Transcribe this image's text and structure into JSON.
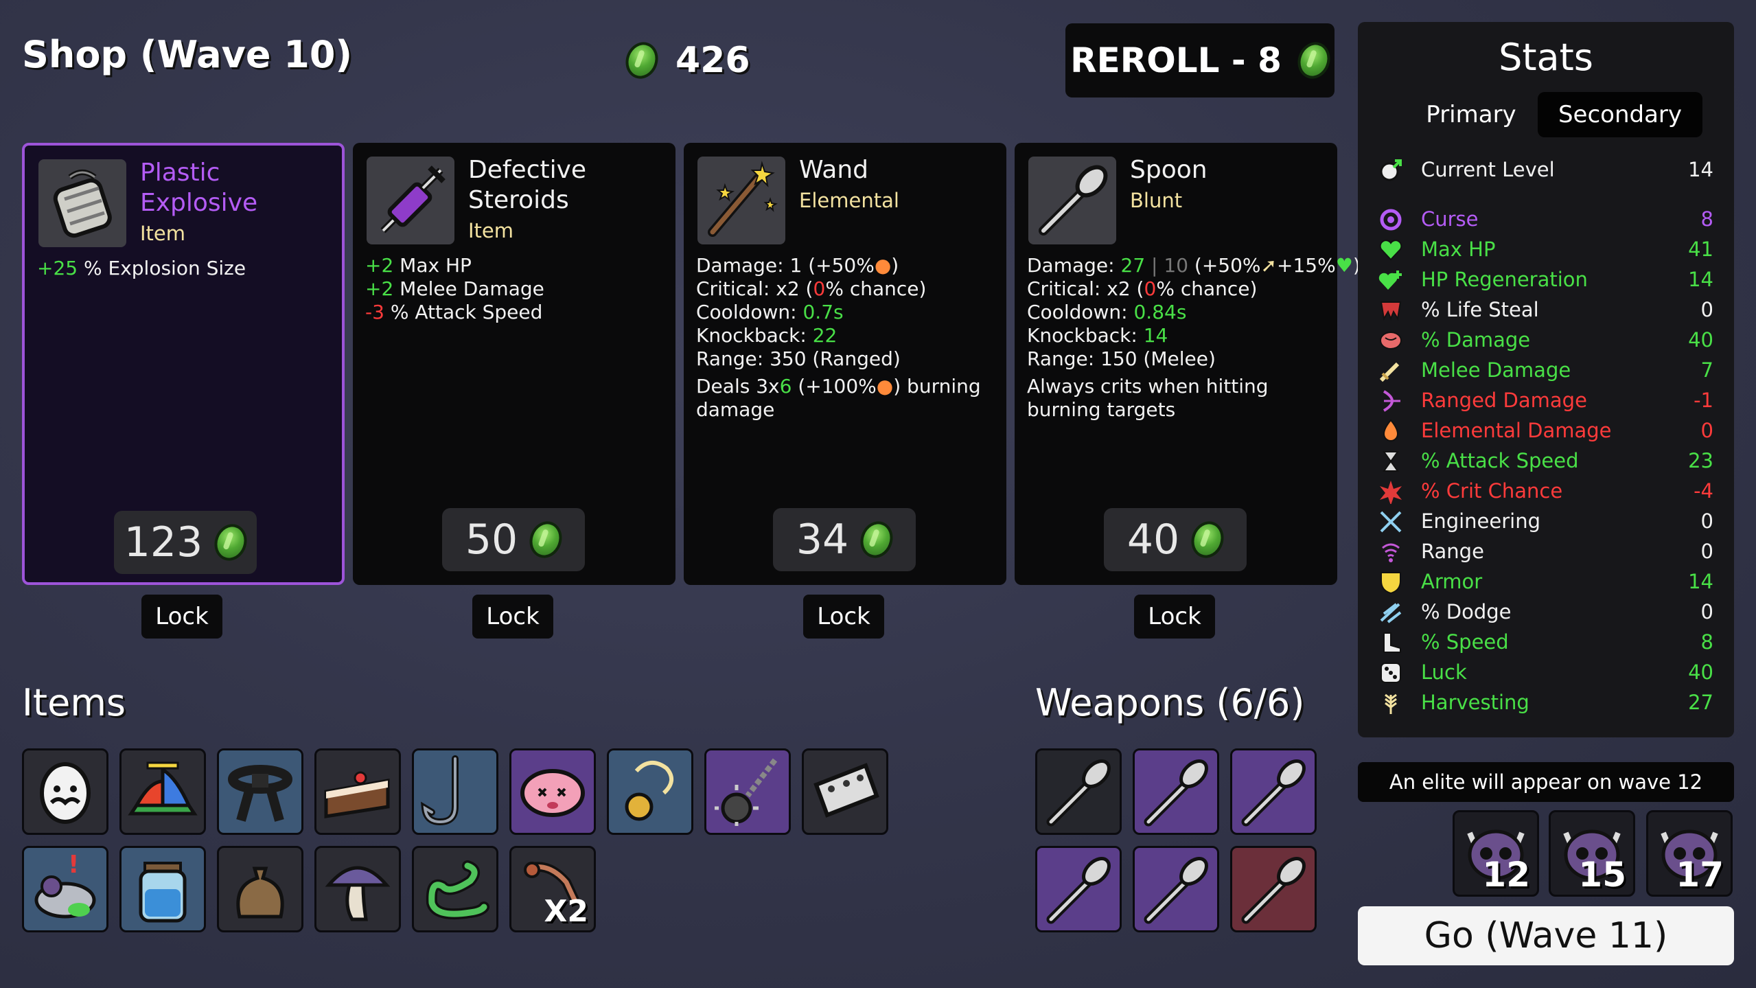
{
  "header": {
    "shop_title": "Shop (Wave 10)",
    "materials": "426",
    "reroll_label": "REROLL - 8"
  },
  "shop": [
    {
      "name_line1": "Plastic",
      "name_line2": "Explosive",
      "type": "Item",
      "effects": [
        {
          "value": "+25",
          "text": " % Explosion Size"
        }
      ],
      "price": "123",
      "lock": "Lock"
    },
    {
      "name_line1": "Defective",
      "name_line2": "Steroids",
      "type": "Item",
      "effects": [
        {
          "value": "+2",
          "text": " Max HP"
        },
        {
          "value": "+2",
          "text": " Melee Damage"
        },
        {
          "value": "-3",
          "text": " % Attack Speed"
        }
      ],
      "price": "50",
      "lock": "Lock"
    },
    {
      "name_line1": "Wand",
      "type": "Elemental",
      "damage": "Damage: 1 (+50%",
      "critical_a": "Critical: x2 (",
      "critical_b": "0",
      "critical_c": "% chance)",
      "cooldown_a": "Cooldown: ",
      "cooldown_b": "0.7s",
      "knockback_a": "Knockback: ",
      "knockback_b": "22",
      "range": "Range: 350 (Ranged)",
      "special_a": "Deals 3x",
      "special_b": "6",
      "special_c": " (+100%",
      "special_d": ") burning",
      "special_e": "damage",
      "price": "34",
      "lock": "Lock"
    },
    {
      "name_line1": "Spoon",
      "type": "Blunt",
      "damage_a": "Damage: ",
      "damage_b": "27",
      "damage_c": " | 10",
      "damage_d": " (+50%",
      "damage_e": "+15%",
      "damage_f": ")",
      "critical_a": "Critical: x2 (",
      "critical_b": "0",
      "critical_c": "% chance)",
      "cooldown_a": "Cooldown: ",
      "cooldown_b": "0.84s",
      "knockback_a": "Knockback: ",
      "knockback_b": "14",
      "range": "Range: 150 (Melee)",
      "special_a": "Always crits when hitting",
      "special_b": "burning targets",
      "price": "40",
      "lock": "Lock"
    }
  ],
  "items_title": "Items",
  "items_qty": "X2",
  "weapons_title": "Weapons (6/6)",
  "stats": {
    "title": "Stats",
    "tabs": [
      "Primary",
      "Secondary"
    ],
    "current_level_label": "Current Level",
    "current_level_value": "14",
    "rows": [
      {
        "label": "Curse",
        "value": "8",
        "color": "#b45cf5",
        "icon": "curse-icon"
      },
      {
        "label": "Max HP",
        "value": "41",
        "color": "#49e047",
        "icon": "heart-icon"
      },
      {
        "label": "HP Regeneration",
        "value": "14",
        "color": "#49e047",
        "icon": "heart-plus-icon"
      },
      {
        "label": "% Life Steal",
        "value": "0",
        "color": "#f2f2f2",
        "icon": "fangs-icon"
      },
      {
        "label": "% Damage",
        "value": "40",
        "color": "#49e047",
        "icon": "brain-icon"
      },
      {
        "label": "Melee Damage",
        "value": "7",
        "color": "#49e047",
        "icon": "sword-icon"
      },
      {
        "label": "Ranged Damage",
        "value": "-1",
        "color": "#ff3b3b",
        "icon": "bow-icon"
      },
      {
        "label": "Elemental Damage",
        "value": "0",
        "color": "#ff3b3b",
        "icon": "flame-icon"
      },
      {
        "label": "% Attack Speed",
        "value": "23",
        "color": "#49e047",
        "icon": "hourglass-icon"
      },
      {
        "label": "% Crit Chance",
        "value": "-4",
        "color": "#ff3b3b",
        "icon": "crit-icon"
      },
      {
        "label": "Engineering",
        "value": "0",
        "color": "#f2f2f2",
        "icon": "wrench-icon"
      },
      {
        "label": "Range",
        "value": "0",
        "color": "#f2f2f2",
        "icon": "range-icon"
      },
      {
        "label": "Armor",
        "value": "14",
        "color": "#49e047",
        "icon": "shield-icon"
      },
      {
        "label": "% Dodge",
        "value": "0",
        "color": "#f2f2f2",
        "icon": "dodge-icon"
      },
      {
        "label": "% Speed",
        "value": "8",
        "color": "#49e047",
        "icon": "boot-icon"
      },
      {
        "label": "Luck",
        "value": "40",
        "color": "#49e047",
        "icon": "dice-icon"
      },
      {
        "label": "Harvesting",
        "value": "27",
        "color": "#49e047",
        "icon": "wheat-icon"
      }
    ]
  },
  "elite_notice": "An elite will appear on wave 12",
  "elite_waves": [
    "12",
    "15",
    "17"
  ],
  "go_button": "Go (Wave 11)"
}
